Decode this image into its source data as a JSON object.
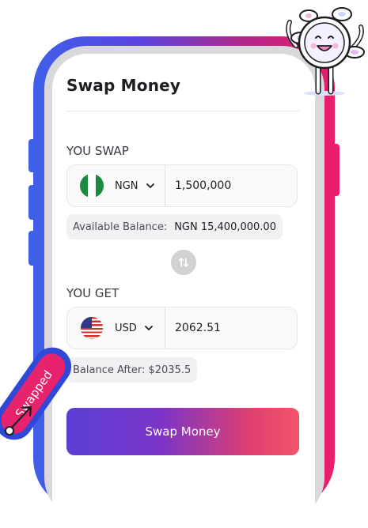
{
  "card": {
    "title": "Swap Money"
  },
  "swap_from": {
    "label": "YOU SWAP",
    "currency": "NGN",
    "amount": "1,500,000",
    "balance_label": "Available Balance:",
    "balance_value": "NGN 15,400,000.00"
  },
  "swap_to": {
    "label": "YOU GET",
    "currency": "USD",
    "amount": "2062.51",
    "balance_after": "Balance After: $2035.5"
  },
  "action": {
    "label": "Swap Money"
  },
  "sticker": {
    "text": "Swapped"
  },
  "icons": {
    "swap_direction": "swap-vertical-icon",
    "dropdown": "chevron-down-icon",
    "flag_from": "nigeria-flag-icon",
    "flag_to": "us-flag-icon",
    "mascot": "mascot-illustration"
  },
  "colors": {
    "frame_left": "#3f5fe8",
    "frame_right": "#ec1d6b",
    "cta_start": "#5b3fd4",
    "cta_end": "#f0566a",
    "sticker_blue": "#2f48d8",
    "sticker_pink": "#e8236e"
  }
}
